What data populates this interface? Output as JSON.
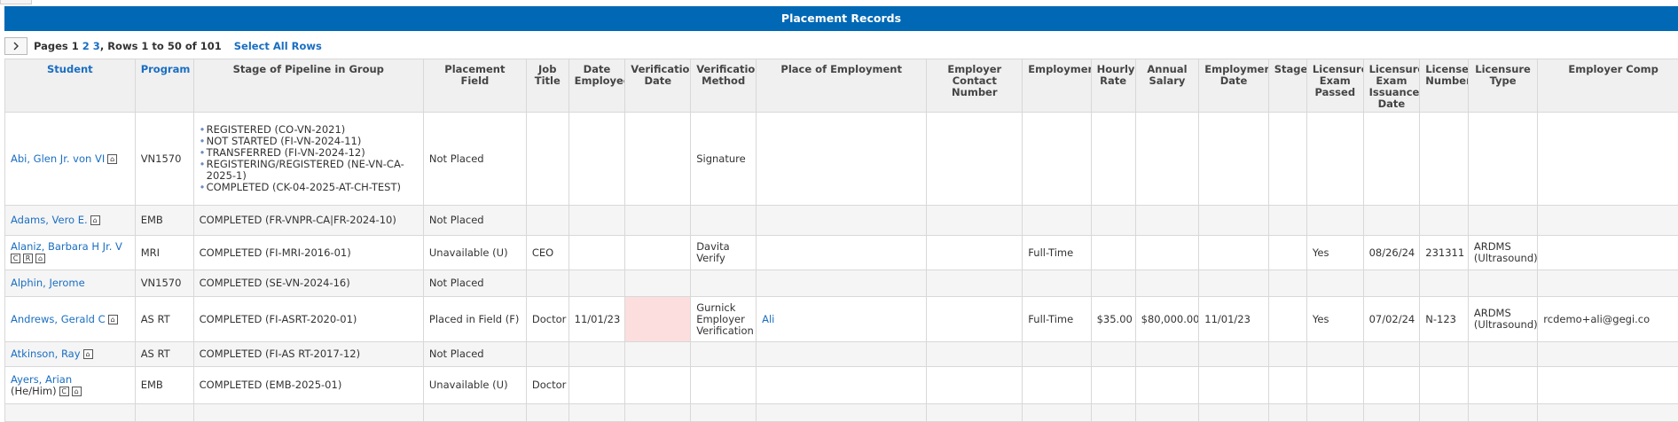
{
  "title": "Placement Records",
  "pager": {
    "pages_label": "Pages",
    "current_page": "1",
    "page_links": [
      "2",
      "3"
    ],
    "rows_text": "Rows 1 to 50 of 101",
    "select_all": "Select All Rows"
  },
  "columns": [
    "Student",
    "Program",
    "Stage of Pipeline in Group",
    "Placement Field",
    "Job Title",
    "Date Employed",
    "Verification Date",
    "Verification Method",
    "Place of Employment",
    "Employer Contact Number",
    "Employment",
    "Hourly Rate",
    "Annual Salary",
    "Employment Date",
    "Stage",
    "Licensure Exam Passed",
    "Licensure Exam Issuance Date",
    "License Number",
    "Licensure Type",
    "Employer Comp"
  ],
  "rows": [
    {
      "student": "Abi, Glen Jr. von VI",
      "student_extra": "",
      "program": "VN1570",
      "pipeline": [
        "REGISTERED (CO-VN-2021)",
        "NOT STARTED (FI-VN-2024-11)",
        "TRANSFERRED (FI-VN-2024-12)",
        "REGISTERING/REGISTERED (NE-VN-CA-2025-1)",
        "COMPLETED (CK-04-2025-AT-CH-TEST)"
      ],
      "placement_field": "Not Placed",
      "job_title": "",
      "date_employed": "",
      "verification_date": "",
      "verification_method": "Signature",
      "place_of_employment": "",
      "employer_contact": "",
      "employment": "",
      "hourly_rate": "",
      "annual_salary": "",
      "employment_date": "",
      "stage": "",
      "exam_passed": "",
      "issuance_date": "",
      "license_number": "",
      "license_type": "",
      "employer_comp": ""
    },
    {
      "student": "Adams, Vero E.",
      "student_extra": "",
      "program": "EMB",
      "pipeline": [
        "COMPLETED (FR-VNPR-CA|FR-2024-10)"
      ],
      "placement_field": "Not Placed",
      "job_title": "",
      "date_employed": "",
      "verification_date": "",
      "verification_method": "",
      "place_of_employment": "",
      "employer_contact": "",
      "employment": "",
      "hourly_rate": "",
      "annual_salary": "",
      "employment_date": "",
      "stage": "",
      "exam_passed": "",
      "issuance_date": "",
      "license_number": "",
      "license_type": "",
      "employer_comp": ""
    },
    {
      "student": "Alaniz, Barbara H Jr. V",
      "student_extra": "",
      "program": "MRI",
      "pipeline": [
        "COMPLETED (FI-MRI-2016-01)"
      ],
      "placement_field": "Unavailable (U)",
      "job_title": "CEO",
      "date_employed": "",
      "verification_date": "",
      "verification_method": "Davita Verify",
      "place_of_employment": "",
      "employer_contact": "",
      "employment": "Full-Time",
      "hourly_rate": "",
      "annual_salary": "",
      "employment_date": "",
      "stage": "",
      "exam_passed": "Yes",
      "issuance_date": "08/26/24",
      "license_number": "231311",
      "license_type": "ARDMS (Ultrasound)",
      "employer_comp": ""
    },
    {
      "student": "Alphin, Jerome",
      "student_extra": "",
      "program": "VN1570",
      "pipeline": [
        "COMPLETED (SE-VN-2024-16)"
      ],
      "placement_field": "Not Placed",
      "job_title": "",
      "date_employed": "",
      "verification_date": "",
      "verification_method": "",
      "place_of_employment": "",
      "employer_contact": "",
      "employment": "",
      "hourly_rate": "",
      "annual_salary": "",
      "employment_date": "",
      "stage": "",
      "exam_passed": "",
      "issuance_date": "",
      "license_number": "",
      "license_type": "",
      "employer_comp": ""
    },
    {
      "student": "Andrews, Gerald C",
      "student_extra": "",
      "program": "AS RT",
      "pipeline": [
        "COMPLETED (FI-ASRT-2020-01)"
      ],
      "placement_field": "Placed in Field (F)",
      "job_title": "Doctor",
      "date_employed": "11/01/23",
      "verification_date": "",
      "verification_method": "Gurnick Employer Verification",
      "place_of_employment": "Ali",
      "employer_contact": "",
      "employment": "Full-Time",
      "hourly_rate": "$35.00",
      "annual_salary": "$80,000.00",
      "employment_date": "11/01/23",
      "stage": "",
      "exam_passed": "Yes",
      "issuance_date": "07/02/24",
      "license_number": "N-123",
      "license_type": "ARDMS (Ultrasound)",
      "employer_comp": "rcdemo+ali@gegi.co"
    },
    {
      "student": "Atkinson, Ray",
      "student_extra": "",
      "program": "AS RT",
      "pipeline": [
        "COMPLETED (FI-AS RT-2017-12)"
      ],
      "placement_field": "Not Placed",
      "job_title": "",
      "date_employed": "",
      "verification_date": "",
      "verification_method": "",
      "place_of_employment": "",
      "employer_contact": "",
      "employment": "",
      "hourly_rate": "",
      "annual_salary": "",
      "employment_date": "",
      "stage": "",
      "exam_passed": "",
      "issuance_date": "",
      "license_number": "",
      "license_type": "",
      "employer_comp": ""
    },
    {
      "student": "Ayers, Arian",
      "student_extra": "(He/Him)",
      "program": "EMB",
      "pipeline": [
        "COMPLETED (EMB-2025-01)"
      ],
      "placement_field": "Unavailable (U)",
      "job_title": "Doctor",
      "date_employed": "",
      "verification_date": "",
      "verification_method": "",
      "place_of_employment": "",
      "employer_contact": "",
      "employment": "",
      "hourly_rate": "",
      "annual_salary": "",
      "employment_date": "",
      "stage": "",
      "exam_passed": "",
      "issuance_date": "",
      "license_number": "",
      "license_type": "",
      "employer_comp": ""
    }
  ],
  "icons": {
    "home": "home-icon",
    "contact": "contact-icon",
    "record": "record-icon"
  },
  "colors": {
    "title_bar": "#0068b5",
    "link": "#1a6ec2",
    "highlight": "#fcdede"
  }
}
